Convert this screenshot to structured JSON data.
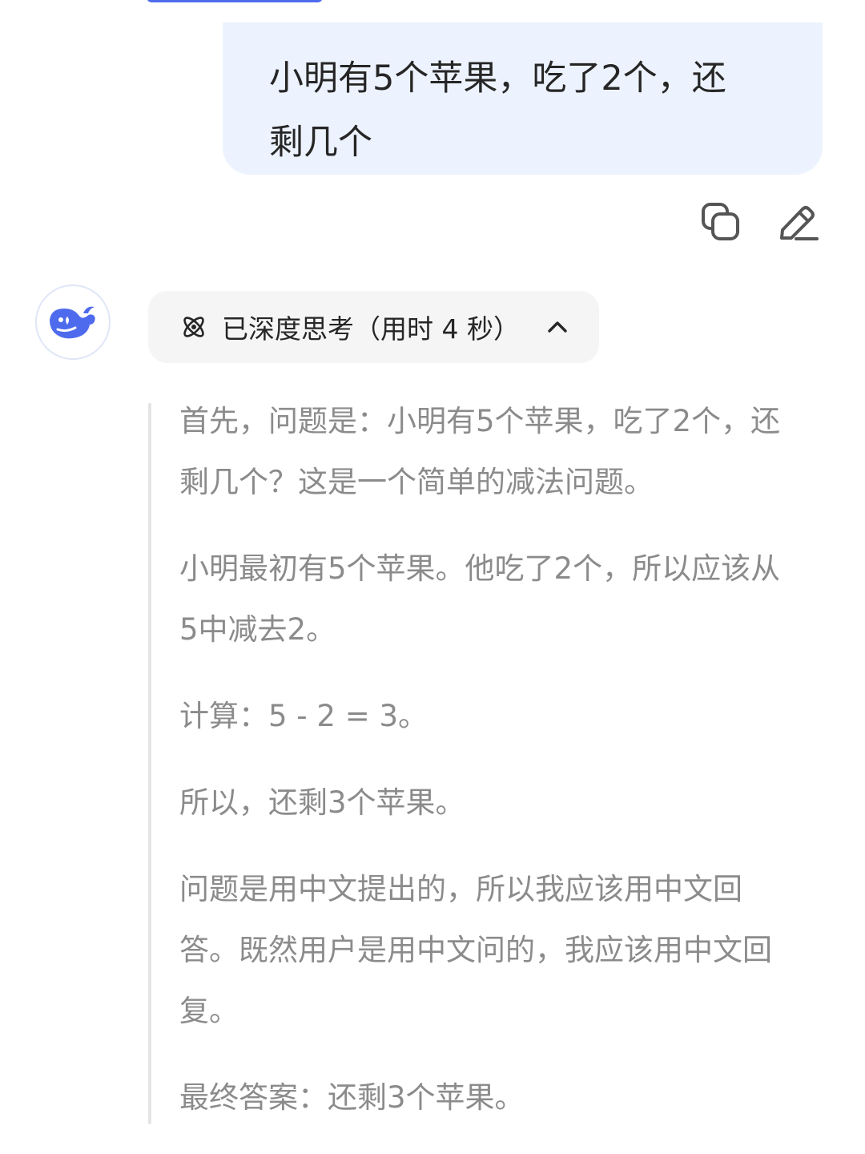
{
  "colors": {
    "accent": "#4f6bed",
    "user_bubble_bg": "#edf3fe",
    "thinking_text": "#8b8b8b",
    "chip_bg": "#f5f5f5"
  },
  "user_message": {
    "line1": "小明有5个苹果，吃了2个，还",
    "line2": "剩几个"
  },
  "message_actions": {
    "copy_icon": "copy-icon",
    "edit_icon": "edit-icon"
  },
  "assistant": {
    "avatar_icon": "whale-logo-icon",
    "thinking_toggle": {
      "label": "已深度思考（用时 4 秒）",
      "icon": "atom-icon",
      "state_icon": "chevron-up-icon"
    },
    "thinking_paragraphs": [
      {
        "lines": [
          "首先，问题是：小明有5个苹果，吃了2个，还",
          "剩几个？这是一个简单的减法问题。"
        ]
      },
      {
        "lines": [
          "小明最初有5个苹果。他吃了2个，所以应该从",
          "5中减去2。"
        ]
      },
      {
        "lines": [
          "计算：5 - 2 = 3。"
        ]
      },
      {
        "lines": [
          "所以，还剩3个苹果。"
        ]
      },
      {
        "lines": [
          "问题是用中文提出的，所以我应该用中文回",
          "答。既然用户是用中文问的，我应该用中文回",
          "复。"
        ]
      },
      {
        "lines": [
          "最终答案：还剩3个苹果。"
        ]
      }
    ]
  }
}
